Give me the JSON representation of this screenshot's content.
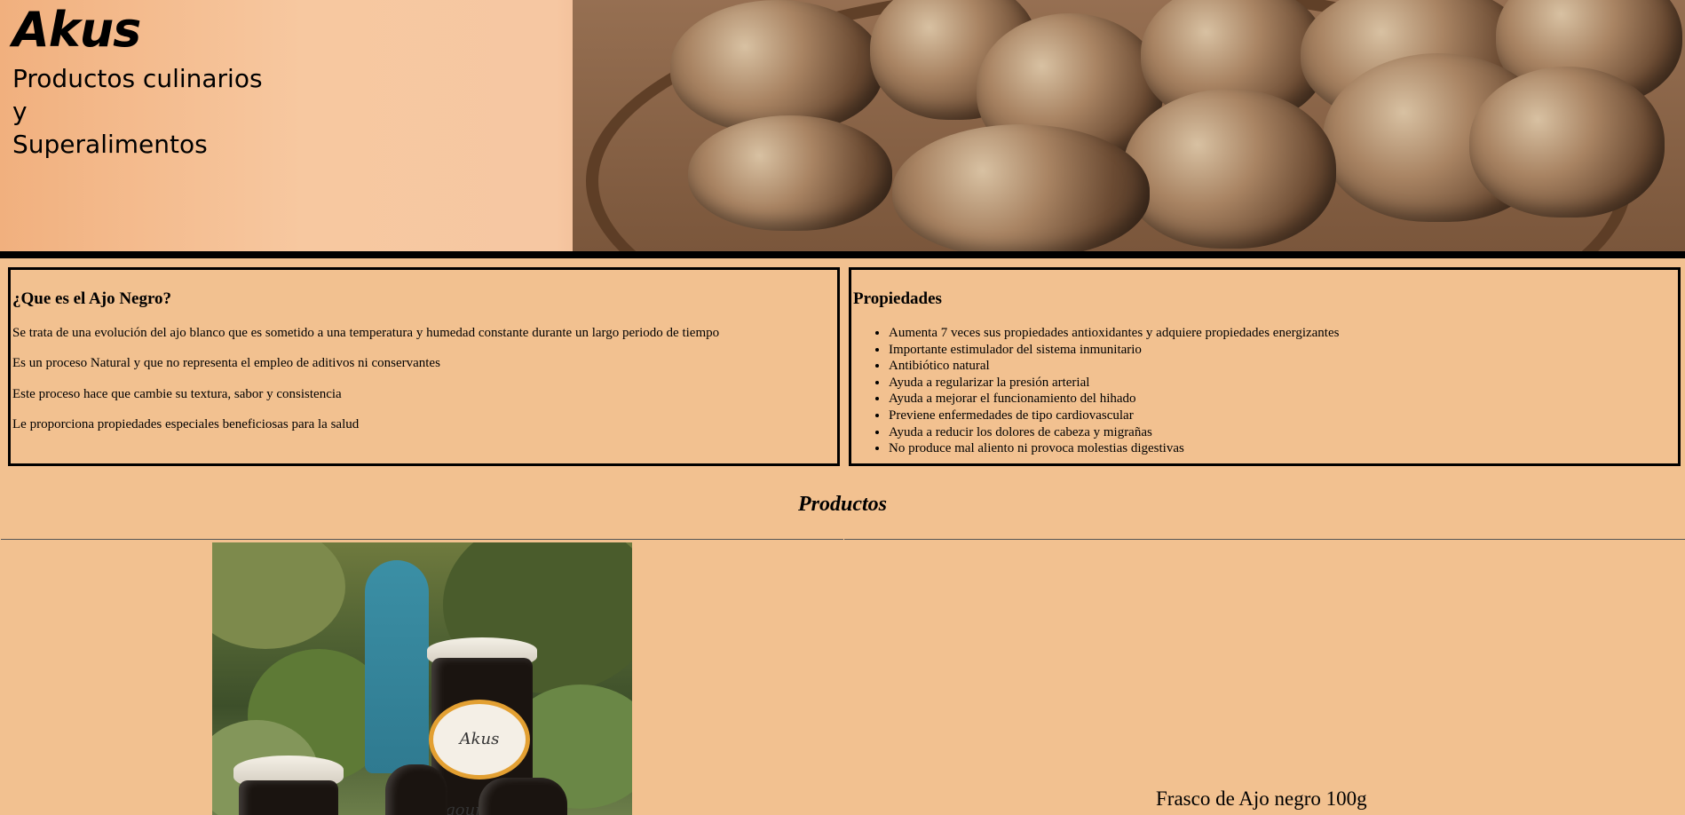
{
  "header": {
    "brand": "Akus",
    "tagline_lines": [
      "Productos culinarios",
      "y",
      "Superalimentos"
    ]
  },
  "que_es": {
    "title": "¿Que es el Ajo Negro?",
    "paragraphs": [
      "Se trata de una evolución del ajo blanco que es sometido a una temperatura y humedad constante durante un largo periodo de tiempo",
      "Es un proceso Natural y que no representa el empleo de aditivos ni conservantes",
      "Este proceso hace que cambie su textura, sabor y consistencia",
      "Le proporciona propiedades especiales beneficiosas para la salud"
    ]
  },
  "propiedades": {
    "title": "Propiedades",
    "items": [
      "Aumenta 7 veces sus propiedades antioxidantes y adquiere propiedades energizantes",
      "Importante estimulador del sistema inmunitario",
      "Antibiótico natural",
      "Ayuda a regularizar la presión arterial",
      "Ayuda a mejorar el funcionamiento del hihado",
      "Previene enfermedades de tipo cardiovascular",
      "Ayuda a reducir los dolores de cabeza y migrañas",
      "No produce mal aliento ni provoca molestias digestivas"
    ]
  },
  "productos": {
    "title": "Productos",
    "items": [
      {
        "name": "Frasco de Ajo negro 100g",
        "label_text": "Akus gourmet"
      }
    ]
  }
}
